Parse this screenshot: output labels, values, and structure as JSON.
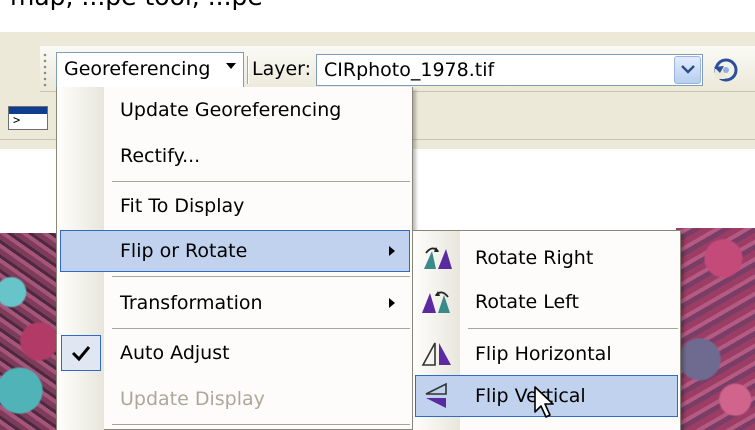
{
  "caption": {
    "text": "map, ...pe tool, ...pe"
  },
  "toolbar": {
    "georef_label": "Georeferencing",
    "layer_label": "Layer:",
    "layer_value": "CIRphoto_1978.tif"
  },
  "menu": {
    "items": [
      {
        "label": "Update Georeferencing",
        "enabled": true
      },
      {
        "label": "Rectify...",
        "enabled": true
      },
      {
        "label": "Fit To Display",
        "enabled": true
      },
      {
        "label": "Flip or Rotate",
        "enabled": true,
        "submenu": true,
        "highlighted": true
      },
      {
        "label": "Transformation",
        "enabled": true,
        "submenu": true
      },
      {
        "label": "Auto Adjust",
        "enabled": true,
        "checked": true
      },
      {
        "label": "Update Display",
        "enabled": false
      }
    ]
  },
  "submenu": {
    "items": [
      {
        "label": "Rotate Right",
        "icon": "rotate-right-icon"
      },
      {
        "label": "Rotate Left",
        "icon": "rotate-left-icon"
      },
      {
        "label": "Flip Horizontal",
        "icon": "flip-horizontal-icon"
      },
      {
        "label": "Flip Vertical",
        "icon": "flip-vertical-icon",
        "highlighted": true
      }
    ]
  },
  "colors": {
    "highlight_fill": "#c1d2ee",
    "highlight_border": "#316ac5",
    "disabled_text": "#aca899",
    "toolbar_bg": "#ece9d8",
    "icon_purple": "#5b2aa0",
    "icon_teal": "#3a8a8a"
  }
}
